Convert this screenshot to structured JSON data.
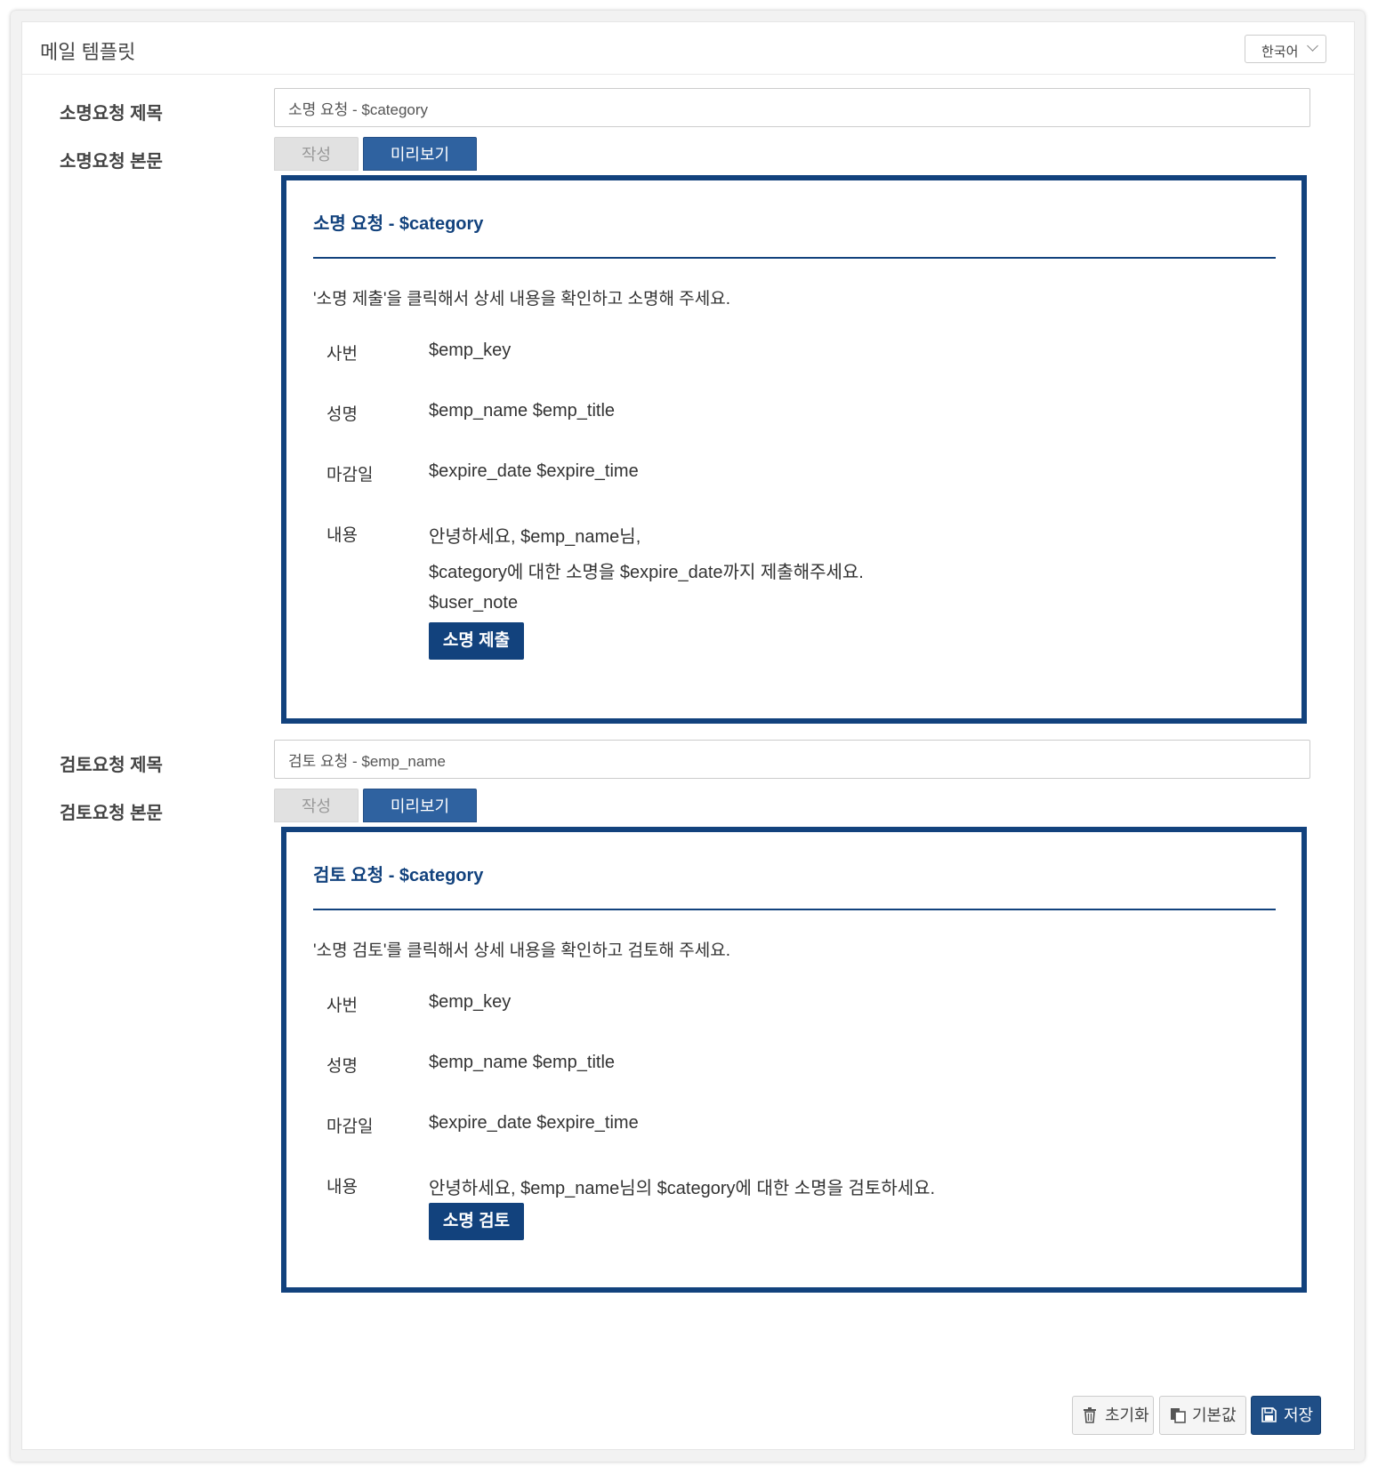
{
  "header": {
    "title": "메일 템플릿",
    "language": "한국어"
  },
  "sections": [
    {
      "subject_label": "소명요청 제목",
      "subject_value": "소명 요청 - $category",
      "body_label": "소명요청 본문",
      "tab_write": "작성",
      "tab_preview": "미리보기",
      "preview": {
        "title": "소명 요청 - $category",
        "intro": "'소명 제출'을 클릭해서 상세 내용을 확인하고 소명해 주세요.",
        "rows": [
          {
            "label": "사번",
            "value": "$emp_key"
          },
          {
            "label": "성명",
            "value": "$emp_name $emp_title"
          },
          {
            "label": "마감일",
            "value": "$expire_date $expire_time"
          },
          {
            "label": "내용",
            "lines": [
              "안녕하세요, $emp_name님,",
              "$category에 대한 소명을 $expire_date까지 제출해주세요.",
              "$user_note"
            ]
          }
        ],
        "button": "소명 제출"
      }
    },
    {
      "subject_label": "검토요청 제목",
      "subject_value": "검토 요청 - $emp_name",
      "body_label": "검토요청 본문",
      "tab_write": "작성",
      "tab_preview": "미리보기",
      "preview": {
        "title": "검토 요청 - $category",
        "intro": "'소명 검토'를 클릭해서 상세 내용을 확인하고 검토해 주세요.",
        "rows": [
          {
            "label": "사번",
            "value": "$emp_key"
          },
          {
            "label": "성명",
            "value": "$emp_name $emp_title"
          },
          {
            "label": "마감일",
            "value": "$expire_date $expire_time"
          },
          {
            "label": "내용",
            "lines": [
              "안녕하세요, $emp_name님의 $category에 대한 소명을 검토하세요."
            ]
          }
        ],
        "button": "소명 검토"
      }
    }
  ],
  "actions": {
    "reset": "초기화",
    "default": "기본값",
    "save": "저장"
  },
  "colors": {
    "accent": "#12427d",
    "tab_active": "#2f62a0",
    "save_button": "#1f4e86"
  }
}
